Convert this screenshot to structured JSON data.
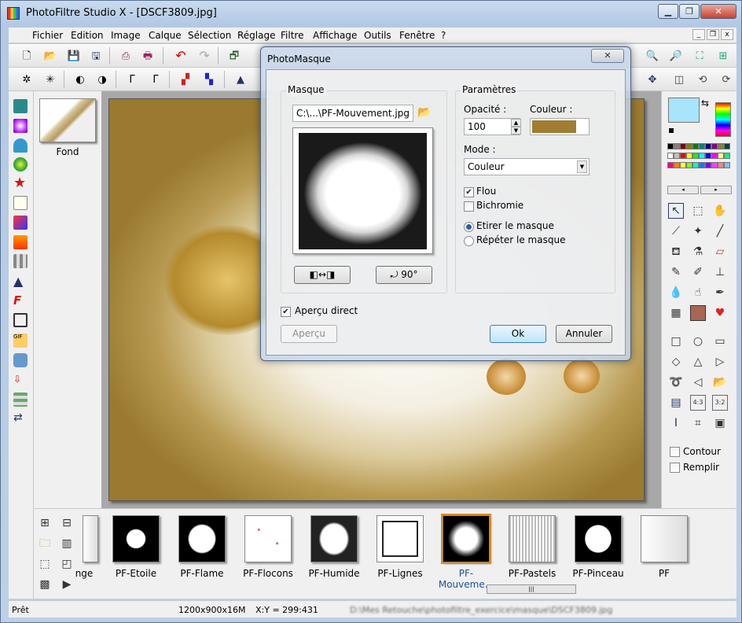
{
  "window": {
    "title": "PhotoFiltre Studio X - [DSCF3809.jpg]"
  },
  "menu": [
    "Fichier",
    "Edition",
    "Image",
    "Calque",
    "Sélection",
    "Réglage",
    "Filtre",
    "Affichage",
    "Outils",
    "Fenêtre",
    "?"
  ],
  "layers": {
    "items": [
      {
        "label": "Fond"
      }
    ]
  },
  "dialog": {
    "title": "PhotoMasque",
    "mask_group": "Masque",
    "mask_path": "C:\\...\\PF-Mouvement.jpg",
    "params_group": "Paramètres",
    "opacity_label": "Opacité :",
    "opacity_value": "100",
    "color_label": "Couleur :",
    "color_value": "#a07d30",
    "mode_label": "Mode :",
    "mode_value": "Couleur",
    "flou_label": "Flou",
    "flou_checked": true,
    "bichromie_label": "Bichromie",
    "bichromie_checked": false,
    "etirer_label": "Etirer le masque",
    "repeter_label": "Répéter le masque",
    "stretch_selected": true,
    "apercu_direct_label": "Aperçu direct",
    "apercu_direct_checked": true,
    "apercu_button": "Aperçu",
    "ok_button": "Ok",
    "cancel_button": "Annuler",
    "rotate_label": "90°"
  },
  "palette": {
    "primary_color": "#a8e4fb",
    "colors": [
      "#000000",
      "#808080",
      "#800000",
      "#808000",
      "#008000",
      "#008080",
      "#000080",
      "#800080",
      "#808040",
      "#004040",
      "#ffffff",
      "#c0c0c0",
      "#ff0000",
      "#ffff00",
      "#00ff00",
      "#00ffff",
      "#0000ff",
      "#ff00ff",
      "#ffff80",
      "#00ff80",
      "#ff0080",
      "#ff8000",
      "#ffff40",
      "#80ff00",
      "#00ffc0",
      "#0080ff",
      "#8000ff",
      "#ff40ff",
      "#ff8080",
      "#80c0ff"
    ]
  },
  "right_options": {
    "contour_label": "Contour",
    "remplir_label": "Remplir"
  },
  "masks": [
    {
      "label": "nge",
      "shape": "partial"
    },
    {
      "label": "PF-Etoile",
      "shape": "star"
    },
    {
      "label": "PF-Flame",
      "shape": "flame"
    },
    {
      "label": "PF-Flocons",
      "shape": "flakes"
    },
    {
      "label": "PF-Humide",
      "shape": "wet"
    },
    {
      "label": "PF-Lignes",
      "shape": "lines"
    },
    {
      "label": "PF-Mouveme...",
      "shape": "motion",
      "selected": true
    },
    {
      "label": "PF-Pastels",
      "shape": "pastels"
    },
    {
      "label": "PF-Pinceau",
      "shape": "brush"
    },
    {
      "label": "PF",
      "shape": "partial"
    }
  ],
  "status": {
    "left": "Prêt",
    "size": "1200x900x16M",
    "coords": "X:Y = 299:431",
    "path": "D:\\Mes Retouche\\photofiltre_exercice\\masque\\DSCF3809.jpg"
  }
}
